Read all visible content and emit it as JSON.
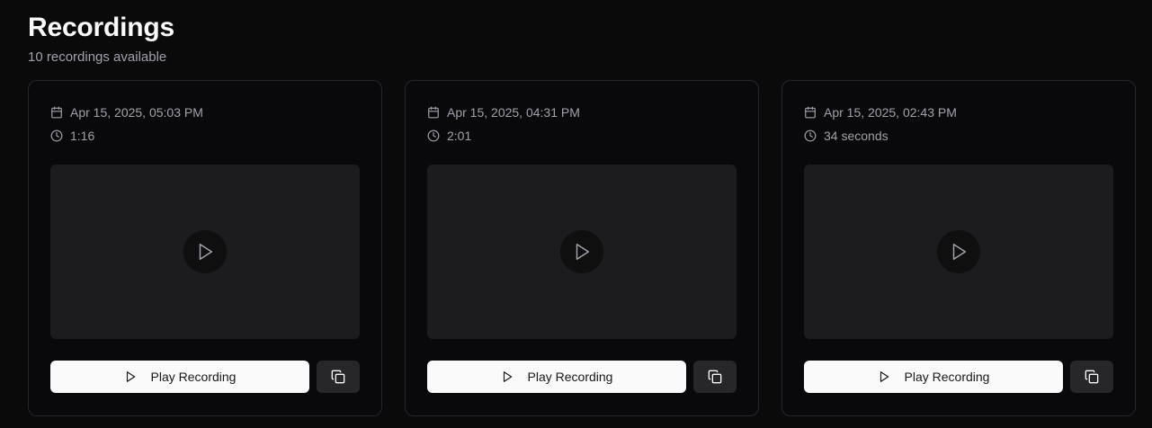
{
  "header": {
    "title": "Recordings",
    "subtitle": "10 recordings available"
  },
  "recordings": [
    {
      "date": "Apr 15, 2025, 05:03 PM",
      "duration": "1:16",
      "play_label": "Play Recording"
    },
    {
      "date": "Apr 15, 2025, 04:31 PM",
      "duration": "2:01",
      "play_label": "Play Recording"
    },
    {
      "date": "Apr 15, 2025, 02:43 PM",
      "duration": "34 seconds",
      "play_label": "Play Recording"
    }
  ],
  "icons": {
    "date": "calendar-icon",
    "duration": "clock-icon",
    "preview": "play-icon",
    "copy": "copy-icon"
  },
  "colors": {
    "background": "#0a0a0b",
    "card_border": "#27272a",
    "preview_bg": "#1c1c1e",
    "primary_button": "#fafafa",
    "secondary_button": "#27272a",
    "muted_text": "#a1a1aa"
  }
}
